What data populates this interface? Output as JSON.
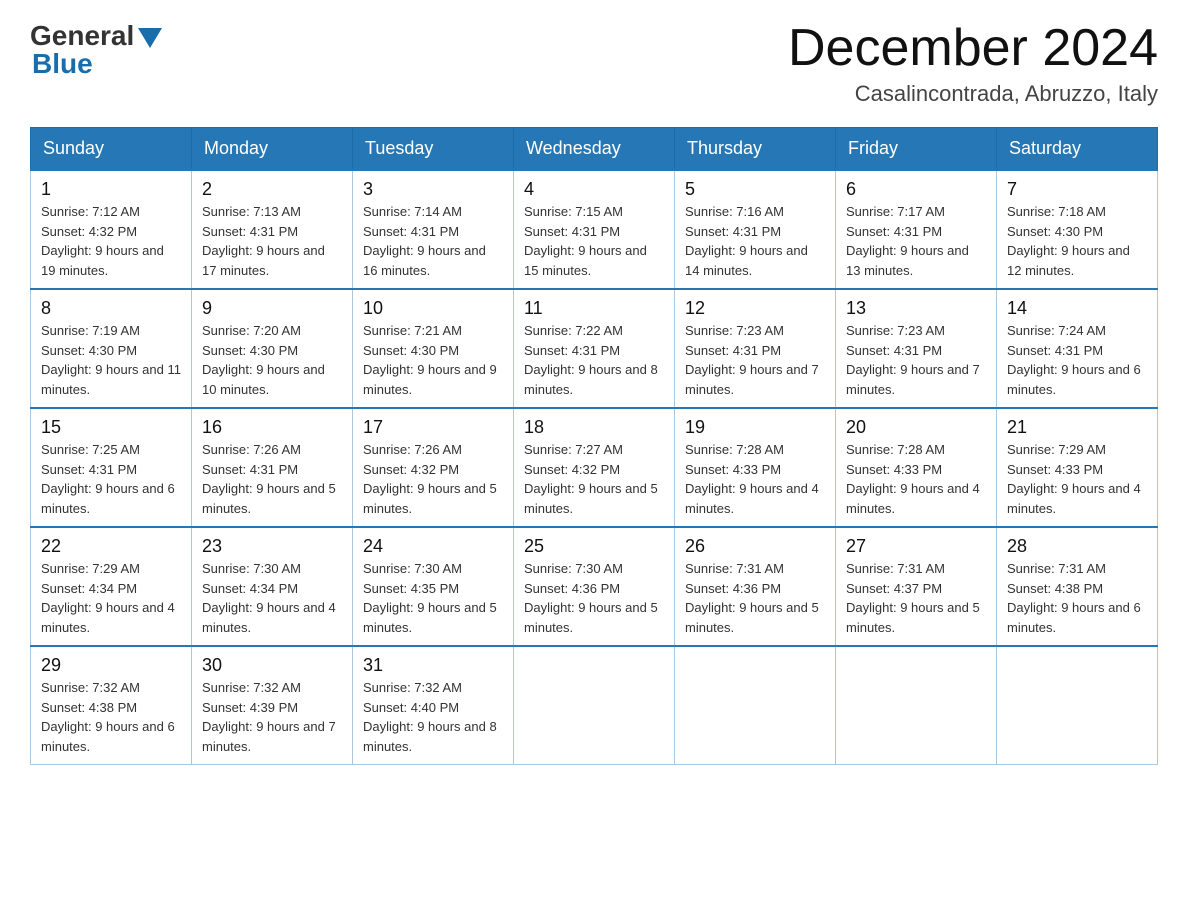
{
  "header": {
    "logo_general": "General",
    "logo_blue": "Blue",
    "title": "December 2024",
    "location": "Casalincontrada, Abruzzo, Italy"
  },
  "weekdays": [
    "Sunday",
    "Monday",
    "Tuesday",
    "Wednesday",
    "Thursday",
    "Friday",
    "Saturday"
  ],
  "weeks": [
    [
      {
        "day": 1,
        "sunrise": "7:12 AM",
        "sunset": "4:32 PM",
        "daylight": "9 hours and 19 minutes."
      },
      {
        "day": 2,
        "sunrise": "7:13 AM",
        "sunset": "4:31 PM",
        "daylight": "9 hours and 17 minutes."
      },
      {
        "day": 3,
        "sunrise": "7:14 AM",
        "sunset": "4:31 PM",
        "daylight": "9 hours and 16 minutes."
      },
      {
        "day": 4,
        "sunrise": "7:15 AM",
        "sunset": "4:31 PM",
        "daylight": "9 hours and 15 minutes."
      },
      {
        "day": 5,
        "sunrise": "7:16 AM",
        "sunset": "4:31 PM",
        "daylight": "9 hours and 14 minutes."
      },
      {
        "day": 6,
        "sunrise": "7:17 AM",
        "sunset": "4:31 PM",
        "daylight": "9 hours and 13 minutes."
      },
      {
        "day": 7,
        "sunrise": "7:18 AM",
        "sunset": "4:30 PM",
        "daylight": "9 hours and 12 minutes."
      }
    ],
    [
      {
        "day": 8,
        "sunrise": "7:19 AM",
        "sunset": "4:30 PM",
        "daylight": "9 hours and 11 minutes."
      },
      {
        "day": 9,
        "sunrise": "7:20 AM",
        "sunset": "4:30 PM",
        "daylight": "9 hours and 10 minutes."
      },
      {
        "day": 10,
        "sunrise": "7:21 AM",
        "sunset": "4:30 PM",
        "daylight": "9 hours and 9 minutes."
      },
      {
        "day": 11,
        "sunrise": "7:22 AM",
        "sunset": "4:31 PM",
        "daylight": "9 hours and 8 minutes."
      },
      {
        "day": 12,
        "sunrise": "7:23 AM",
        "sunset": "4:31 PM",
        "daylight": "9 hours and 7 minutes."
      },
      {
        "day": 13,
        "sunrise": "7:23 AM",
        "sunset": "4:31 PM",
        "daylight": "9 hours and 7 minutes."
      },
      {
        "day": 14,
        "sunrise": "7:24 AM",
        "sunset": "4:31 PM",
        "daylight": "9 hours and 6 minutes."
      }
    ],
    [
      {
        "day": 15,
        "sunrise": "7:25 AM",
        "sunset": "4:31 PM",
        "daylight": "9 hours and 6 minutes."
      },
      {
        "day": 16,
        "sunrise": "7:26 AM",
        "sunset": "4:31 PM",
        "daylight": "9 hours and 5 minutes."
      },
      {
        "day": 17,
        "sunrise": "7:26 AM",
        "sunset": "4:32 PM",
        "daylight": "9 hours and 5 minutes."
      },
      {
        "day": 18,
        "sunrise": "7:27 AM",
        "sunset": "4:32 PM",
        "daylight": "9 hours and 5 minutes."
      },
      {
        "day": 19,
        "sunrise": "7:28 AM",
        "sunset": "4:33 PM",
        "daylight": "9 hours and 4 minutes."
      },
      {
        "day": 20,
        "sunrise": "7:28 AM",
        "sunset": "4:33 PM",
        "daylight": "9 hours and 4 minutes."
      },
      {
        "day": 21,
        "sunrise": "7:29 AM",
        "sunset": "4:33 PM",
        "daylight": "9 hours and 4 minutes."
      }
    ],
    [
      {
        "day": 22,
        "sunrise": "7:29 AM",
        "sunset": "4:34 PM",
        "daylight": "9 hours and 4 minutes."
      },
      {
        "day": 23,
        "sunrise": "7:30 AM",
        "sunset": "4:34 PM",
        "daylight": "9 hours and 4 minutes."
      },
      {
        "day": 24,
        "sunrise": "7:30 AM",
        "sunset": "4:35 PM",
        "daylight": "9 hours and 5 minutes."
      },
      {
        "day": 25,
        "sunrise": "7:30 AM",
        "sunset": "4:36 PM",
        "daylight": "9 hours and 5 minutes."
      },
      {
        "day": 26,
        "sunrise": "7:31 AM",
        "sunset": "4:36 PM",
        "daylight": "9 hours and 5 minutes."
      },
      {
        "day": 27,
        "sunrise": "7:31 AM",
        "sunset": "4:37 PM",
        "daylight": "9 hours and 5 minutes."
      },
      {
        "day": 28,
        "sunrise": "7:31 AM",
        "sunset": "4:38 PM",
        "daylight": "9 hours and 6 minutes."
      }
    ],
    [
      {
        "day": 29,
        "sunrise": "7:32 AM",
        "sunset": "4:38 PM",
        "daylight": "9 hours and 6 minutes."
      },
      {
        "day": 30,
        "sunrise": "7:32 AM",
        "sunset": "4:39 PM",
        "daylight": "9 hours and 7 minutes."
      },
      {
        "day": 31,
        "sunrise": "7:32 AM",
        "sunset": "4:40 PM",
        "daylight": "9 hours and 8 minutes."
      },
      null,
      null,
      null,
      null
    ]
  ]
}
